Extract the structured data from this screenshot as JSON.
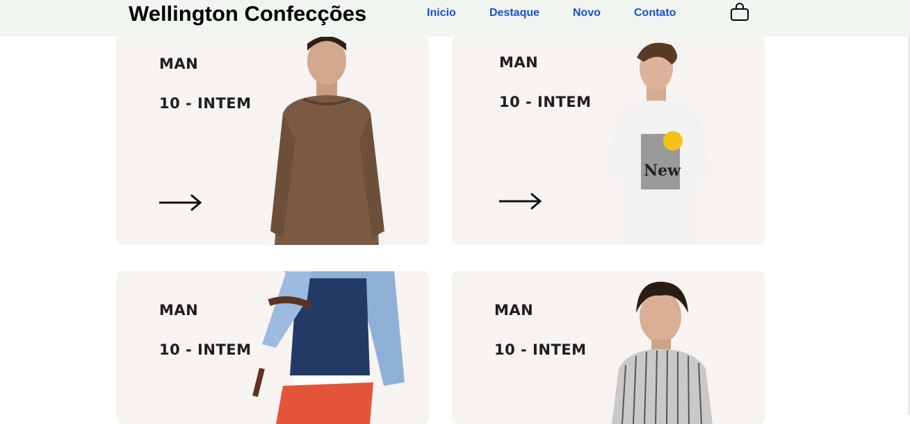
{
  "header": {
    "brand": "Wellington Confecções",
    "nav": [
      {
        "label": "Inicio"
      },
      {
        "label": "Destaque"
      },
      {
        "label": "Novo"
      },
      {
        "label": "Contato"
      }
    ],
    "cart_icon": "shopping-bag-icon"
  },
  "cards": [
    {
      "category": "MAN",
      "count": "10 - INTEM",
      "product": "brown knit sweater",
      "has_arrow": true
    },
    {
      "category": "MAN",
      "count": "10 - INTEM",
      "product": "white New York t-shirt",
      "has_arrow": true
    },
    {
      "category": "MAN",
      "count": "10 - INTEM",
      "product": "denim shirt and navy sweater"
    },
    {
      "category": "MAN",
      "count": "10 - INTEM",
      "product": "striped button shirt"
    }
  ],
  "colors": {
    "header_bg": "#f0f5f0",
    "nav_link": "#1a4fd0",
    "card_bg": "#f6f3f1"
  }
}
